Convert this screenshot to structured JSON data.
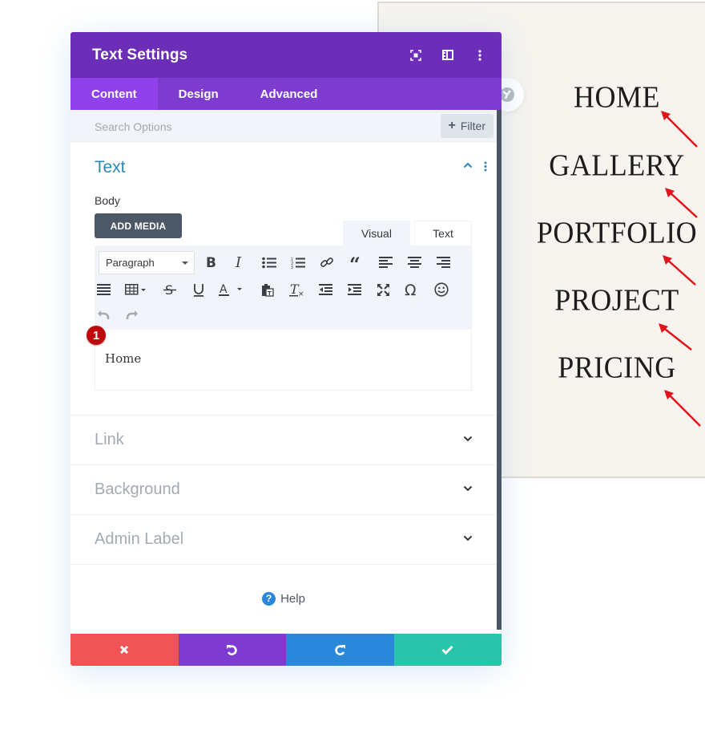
{
  "modal": {
    "title": "Text Settings",
    "header_icons": [
      "focus-mode-icon",
      "split-view-icon",
      "more-options-icon"
    ],
    "tabs": [
      {
        "label": "Content",
        "active": true
      },
      {
        "label": "Design",
        "active": false
      },
      {
        "label": "Advanced",
        "active": false
      }
    ],
    "search": {
      "placeholder": "Search Options",
      "value": ""
    },
    "filter_label": "Filter",
    "sections": {
      "text": {
        "title": "Text",
        "body_label": "Body",
        "add_media_label": "ADD MEDIA",
        "editor_tabs": {
          "visual": "Visual",
          "text": "Text"
        },
        "format_select": "Paragraph",
        "toolbar_row1": [
          "bold",
          "italic",
          "bulleted-list",
          "numbered-list",
          "link",
          "blockquote",
          "align-left",
          "align-center",
          "align-right"
        ],
        "toolbar_row2": [
          "justify",
          "table",
          "strikethrough",
          "underline",
          "text-color",
          "paste-as-text",
          "clear-formatting",
          "outdent",
          "indent",
          "fullscreen",
          "special-character",
          "emoticons"
        ],
        "toolbar_row3": [
          "undo",
          "redo"
        ],
        "content": "Home",
        "badge": "1"
      },
      "collapsed": [
        {
          "label": "Link"
        },
        {
          "label": "Background"
        },
        {
          "label": "Admin Label"
        }
      ]
    },
    "help_label": "Help",
    "footer": {
      "buttons": [
        {
          "name": "discard",
          "icon": "close-icon",
          "color": "#ef5555"
        },
        {
          "name": "undo",
          "icon": "undo-icon",
          "color": "#7e3bd0"
        },
        {
          "name": "redo",
          "icon": "redo-icon",
          "color": "#2b87da"
        },
        {
          "name": "save",
          "icon": "check-icon",
          "color": "#29c4a9"
        }
      ]
    },
    "colors": {
      "header": "#6c2eb9",
      "tabs": "#7e3bd0",
      "active_tab": "#8f42ec",
      "accent_title": "#2b87b5",
      "badge": "#c0070d"
    }
  },
  "preview": {
    "menu_items": [
      "HOME",
      "GALLERY",
      "PORTFOLIO",
      "PROJECT",
      "PRICING"
    ],
    "arrow_color": "#e0141a"
  }
}
